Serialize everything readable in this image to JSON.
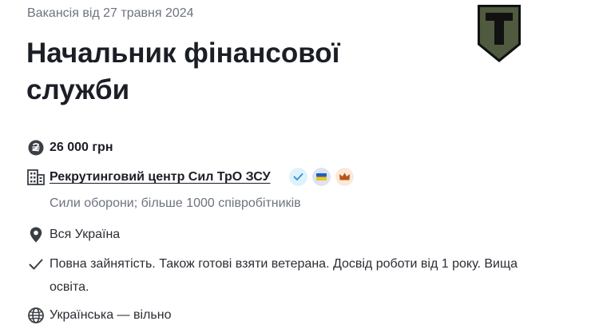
{
  "vacancy": {
    "date_line": "Вакансія від 27 травня 2024",
    "title": "Начальник фінансової служби",
    "salary": "26 000 грн",
    "company": "Рекрутинговий центр Сил ТрО ЗСУ",
    "company_details": "Сили оборони; більше 1000 співробітників",
    "location": "Вся Україна",
    "employment": "Повна зайнятість. Також готові взяти ветерана. Досвід роботи від 1 року. Вища освіта.",
    "language": "Українська — вільно"
  },
  "icons": {
    "salary": "hryvnia-coin-icon",
    "company": "office-building-icon",
    "location": "map-pin-icon",
    "employment": "checkmark-icon",
    "language": "globe-icon",
    "badge_verified": "verified-check-icon",
    "badge_ukraine": "ukraine-flag-icon",
    "badge_crown": "crown-icon",
    "company_logo": "company-shield-logo"
  },
  "colors": {
    "title": "#1b1e26",
    "muted_text": "#6e7380",
    "logo_fill": "#4f5a3f",
    "logo_border": "#111111",
    "verified_badge_bg": "#dff2fb",
    "verified_badge_check": "#3a9ad9",
    "flag_blue": "#1f5fbf",
    "flag_yellow": "#f5c518",
    "crown_badge_bg": "#fbe9d9",
    "crown": "#b8541a"
  }
}
